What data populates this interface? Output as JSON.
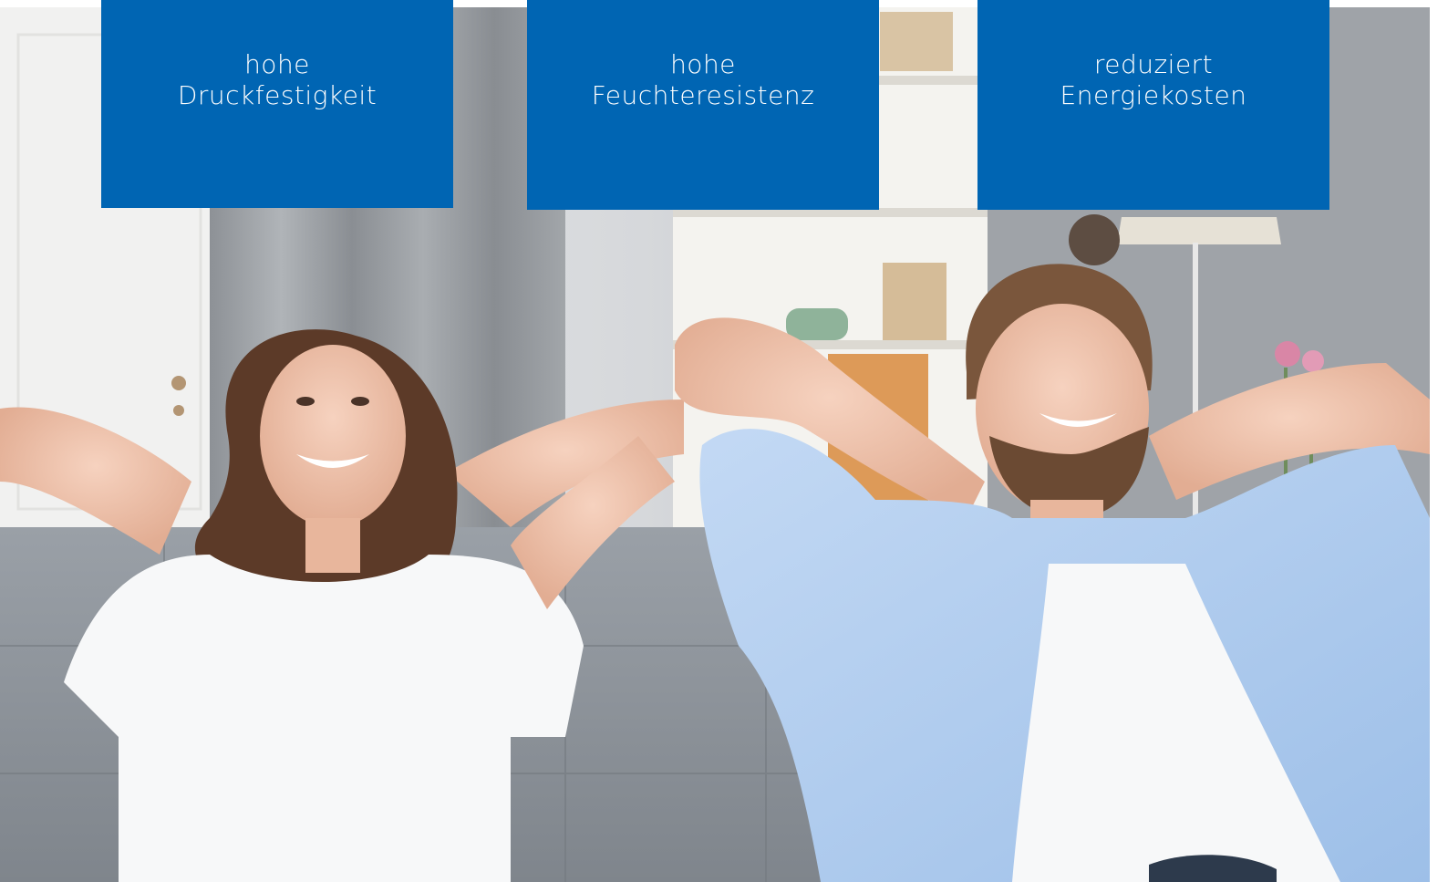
{
  "features": [
    {
      "line1": "hohe",
      "line2": "Druckfestigkeit"
    },
    {
      "line1": "hohe",
      "line2": "Feuchteresistenz"
    },
    {
      "line1": "reduziert",
      "line2": "Energiekosten"
    }
  ],
  "colors": {
    "brand_blue": "#0065b3",
    "text_on_blue": "#ffffff"
  }
}
